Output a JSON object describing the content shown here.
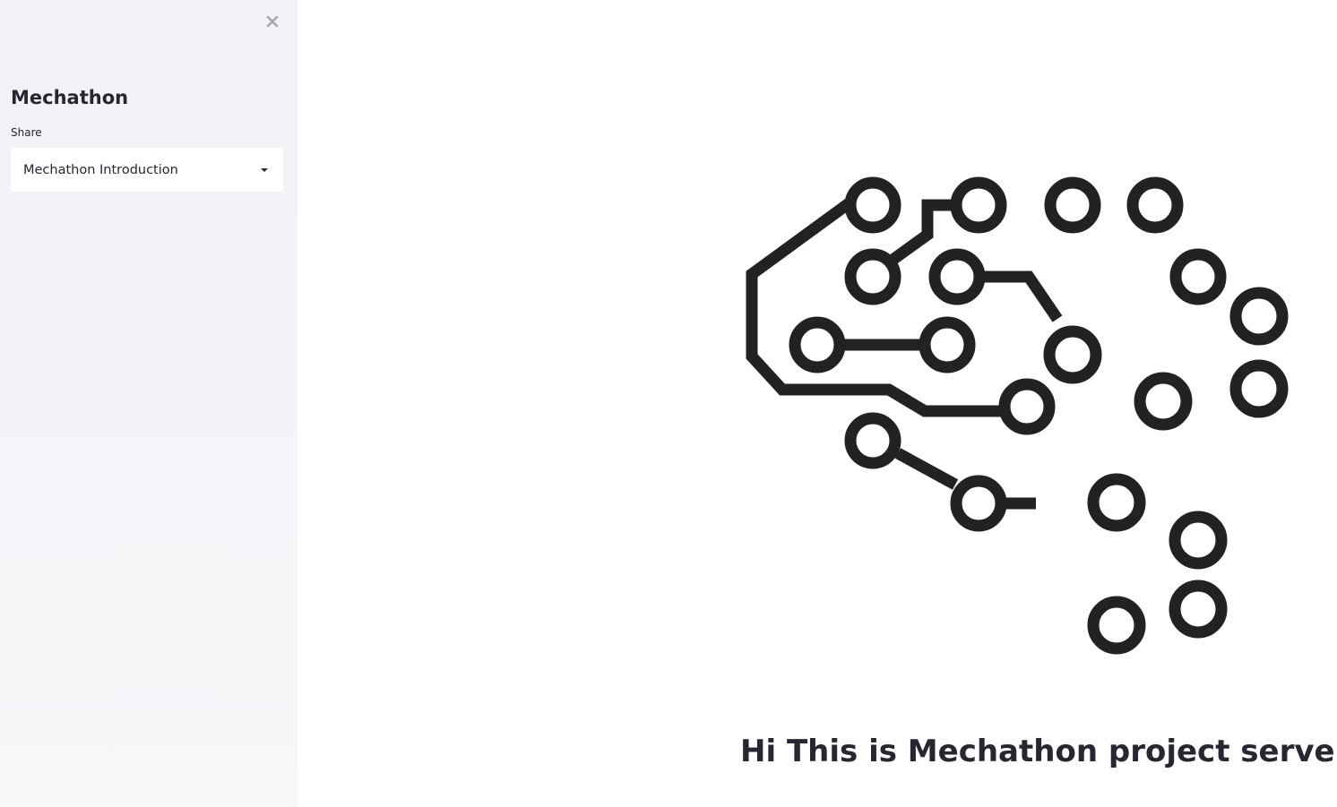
{
  "sidebar": {
    "close_icon": "close-icon",
    "title": "Mechathon",
    "select_label": "Share",
    "select_value": "Mechathon Introduction"
  },
  "main": {
    "image_icon": "brain-circuit-icon",
    "heading": "Hi This is Mechathon project server"
  },
  "colors": {
    "sidebar_bg": "#f0f2f6",
    "text": "#262730",
    "logo_stroke": "#222222",
    "close_icon": "#a3a8b4"
  }
}
